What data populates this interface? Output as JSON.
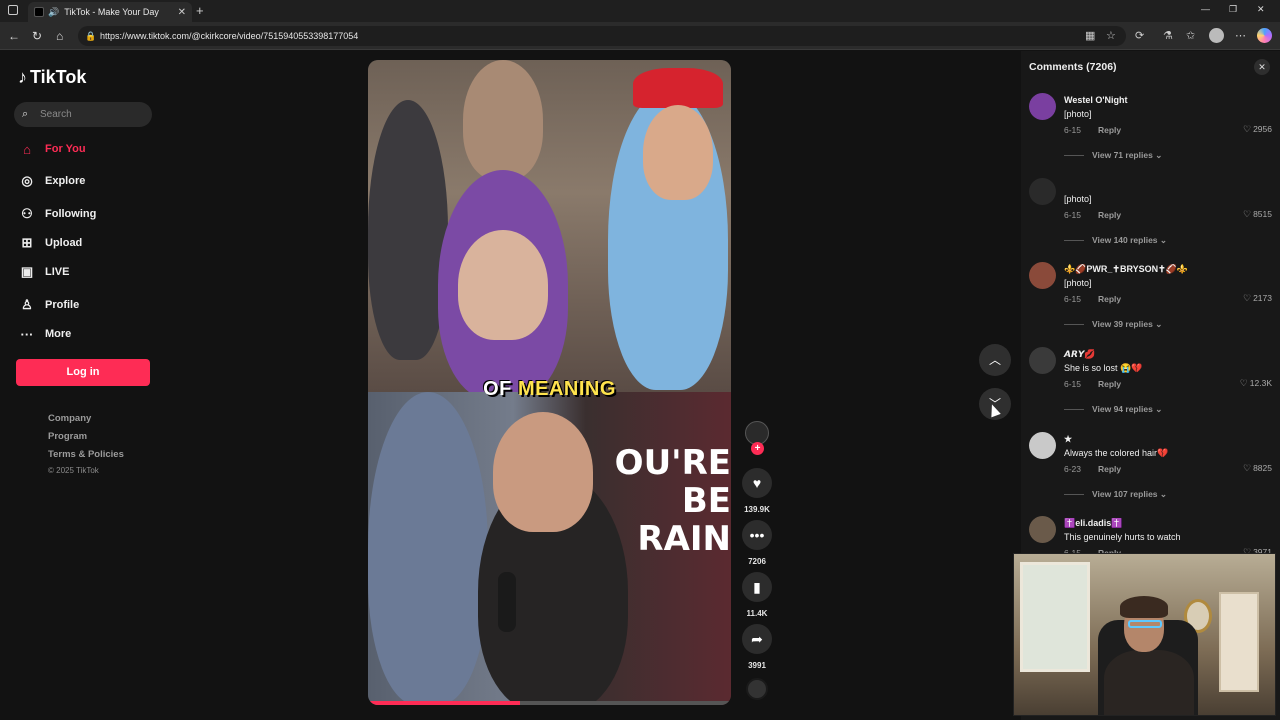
{
  "browser": {
    "tab_title": "TikTok - Make Your Day",
    "url": "https://www.tiktok.com/@ckirkcore/video/7515940553398177054"
  },
  "brand": {
    "name": "TikTok",
    "accent": "#fe2c55"
  },
  "search": {
    "placeholder": "Search"
  },
  "nav": [
    {
      "label": "For You",
      "icon": "home-icon"
    },
    {
      "label": "Explore",
      "icon": "compass-icon"
    },
    {
      "label": "Following",
      "icon": "following-icon"
    },
    {
      "label": "Upload",
      "icon": "upload-icon"
    },
    {
      "label": "LIVE",
      "icon": "live-icon"
    },
    {
      "label": "Profile",
      "icon": "profile-icon"
    },
    {
      "label": "More",
      "icon": "more-icon"
    }
  ],
  "login_label": "Log in",
  "footer": {
    "links": [
      "Company",
      "Program",
      "Terms & Policies"
    ],
    "copyright": "© 2025 TikTok"
  },
  "video": {
    "caption_a": "OF ",
    "caption_b": "MEANING",
    "sign_text": "OU'RE BE RAIN",
    "progress": 0.42
  },
  "actions": {
    "likes": "139.9K",
    "comments": "7206",
    "saves": "11.4K",
    "shares": "3991"
  },
  "comments_panel": {
    "title": "Comments (7206)",
    "items": [
      {
        "user": "Westel O'Night",
        "text": "[photo]",
        "date": "6-15",
        "reply": "Reply",
        "likes": "2956",
        "views": "View 71 replies",
        "avatar": "#7a3fa0"
      },
      {
        "user": "",
        "text": "[photo]",
        "date": "6-15",
        "reply": "Reply",
        "likes": "8515",
        "views": "View 140 replies",
        "avatar": "#2a2a2a"
      },
      {
        "user": "⚜️🏈PWR_✝BRYSON✝🏈⚜️",
        "text": "[photo]",
        "date": "6-15",
        "reply": "Reply",
        "likes": "2173",
        "views": "View 39 replies",
        "avatar": "#8a4a3a"
      },
      {
        "user": "𝘼𝙍𝙔💋",
        "text": "She is so lost 😭💔",
        "date": "6-15",
        "reply": "Reply",
        "likes": "12.3K",
        "views": "View 94 replies",
        "avatar": "#3a3a3a"
      },
      {
        "user": "★",
        "text": "Always the colored hair💔",
        "date": "6-23",
        "reply": "Reply",
        "likes": "8825",
        "views": "View 107 replies",
        "avatar": "#c9c9c9"
      },
      {
        "user": "✝️eli.dadis✝️",
        "text": "This genuinely hurts to watch",
        "date": "6-15",
        "reply": "Reply",
        "likes": "3971",
        "views": "",
        "avatar": "#6a5a4a"
      }
    ]
  }
}
